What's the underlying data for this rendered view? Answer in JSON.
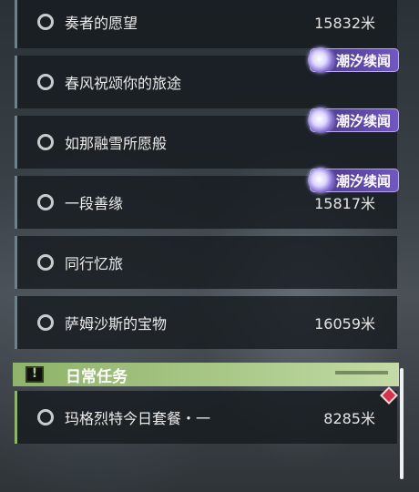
{
  "quests": [
    {
      "title": "奏者的愿望",
      "distance": "15832米"
    },
    {
      "title": "春风祝颂你的旅途",
      "distance": ""
    },
    {
      "title": "如那融雪所愿般",
      "distance": ""
    },
    {
      "title": "一段善缘",
      "distance": "15817米"
    },
    {
      "title": "同行忆旅",
      "distance": ""
    },
    {
      "title": "萨姆沙斯的宝物",
      "distance": "16059米"
    }
  ],
  "tags": [
    {
      "label": "潮汐续闻",
      "icon": "tidal-swirl-icon"
    },
    {
      "label": "潮汐续闻",
      "icon": "tidal-swirl-icon"
    },
    {
      "label": "潮汐续闻",
      "icon": "tidal-swirl-icon"
    }
  ],
  "daily_section": {
    "label": "日常任务",
    "icon": "exclamation-box-icon",
    "accent": "#a8c888",
    "items": [
      {
        "title": "玛格烈特今日套餐・一",
        "distance": "8285米"
      }
    ]
  },
  "colors": {
    "tag_purple": "#5f4aa8",
    "marker_red": "#d6324a",
    "quest_bg": "#161b20"
  }
}
